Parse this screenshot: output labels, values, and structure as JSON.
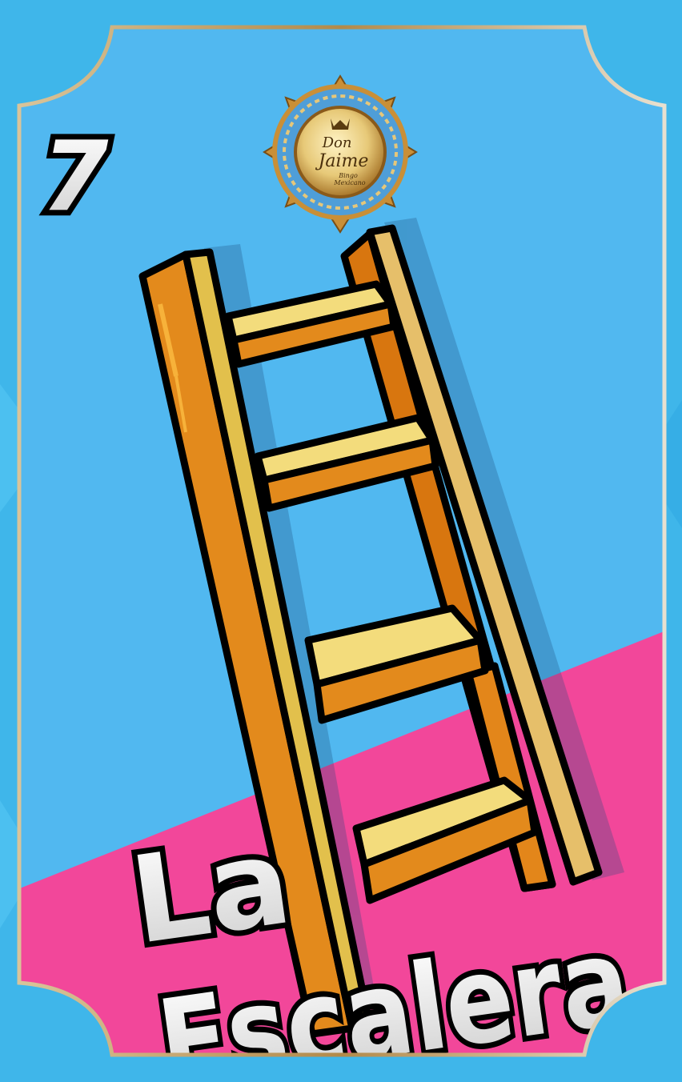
{
  "card": {
    "number": "7",
    "title_line1": "La",
    "title_line2": "Escalera"
  },
  "brand": {
    "logo_line1": "Don",
    "logo_line2": "Jaime",
    "logo_tagline1": "Bingo",
    "logo_tagline2": "Mexicano"
  },
  "colors": {
    "outer_background": "#3fb6ea",
    "card_sky": "#51b8f0",
    "card_floor": "#f2479a",
    "frame_gold": "#c9a968",
    "ladder_wood": "#e38a1c",
    "ladder_light": "#f3dc7c",
    "text_fill": "#f2f2f2",
    "outline": "#000000"
  },
  "icons": [
    "don-jaime-crest-logo",
    "ladder-illustration"
  ]
}
